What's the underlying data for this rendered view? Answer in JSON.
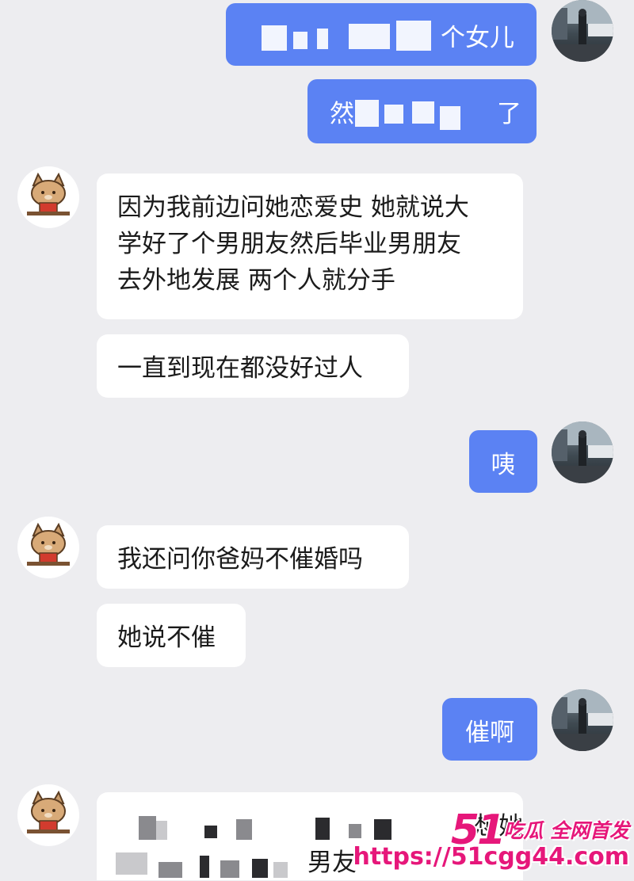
{
  "colors": {
    "background": "#ededf0",
    "incoming_bubble": "#ffffff",
    "outgoing_bubble": "#5b82f3",
    "watermark": "#e6177a"
  },
  "avatars": {
    "contact": "cat-avatar-icon",
    "self": "photo-avatar"
  },
  "messages": [
    {
      "side": "out",
      "lines": [
        "个女儿"
      ]
    },
    {
      "side": "out",
      "lines": [
        "然",
        "了"
      ]
    },
    {
      "side": "in",
      "lines": [
        "因为我前边问她恋爱史 她就说大",
        "学好了个男朋友然后毕业男朋友",
        "去外地发展 两个人就分手"
      ]
    },
    {
      "side": "in",
      "lines": [
        "一直到现在都没好过人"
      ]
    },
    {
      "side": "out",
      "lines": [
        "咦"
      ]
    },
    {
      "side": "in",
      "lines": [
        "我还问你爸妈不催婚吗"
      ]
    },
    {
      "side": "in",
      "lines": [
        "她说不催"
      ]
    },
    {
      "side": "out",
      "lines": [
        "催啊"
      ]
    },
    {
      "side": "in",
      "lines": [
        "想她",
        "男友"
      ]
    }
  ],
  "watermark": {
    "brand_number": "51",
    "brand_text": "吃瓜 全网首发",
    "url": "https://51cgg44.com"
  }
}
